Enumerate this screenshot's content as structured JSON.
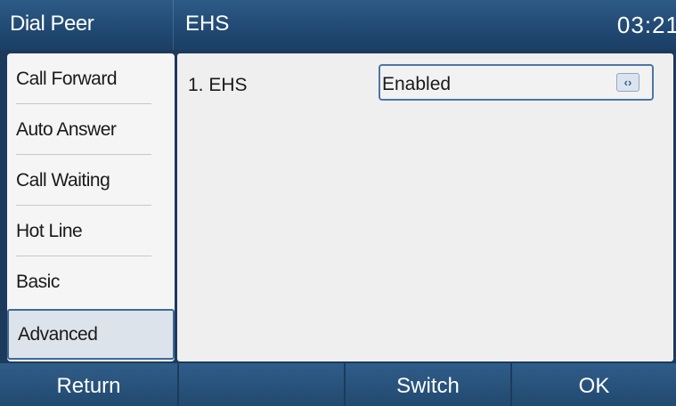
{
  "header": {
    "left_title": "Dial Peer",
    "page_title": "EHS",
    "time": "03:21"
  },
  "sidebar": {
    "items": [
      {
        "label": "Call Forward"
      },
      {
        "label": "Auto Answer"
      },
      {
        "label": "Call Waiting"
      },
      {
        "label": "Hot Line"
      },
      {
        "label": "Basic"
      },
      {
        "label": "Advanced"
      }
    ],
    "active_item": "Advanced"
  },
  "main": {
    "rows": [
      {
        "label": "1. EHS",
        "value": "Enabled",
        "control_icon": "left-right-arrows-icon"
      }
    ]
  },
  "softkeys": [
    "Return",
    "",
    "Switch",
    "OK"
  ],
  "colors": {
    "header_bg": "#214a74",
    "frame_bg": "#1d3a5c",
    "panel_bg": "#efefef",
    "accent_border": "#4a77a6"
  }
}
